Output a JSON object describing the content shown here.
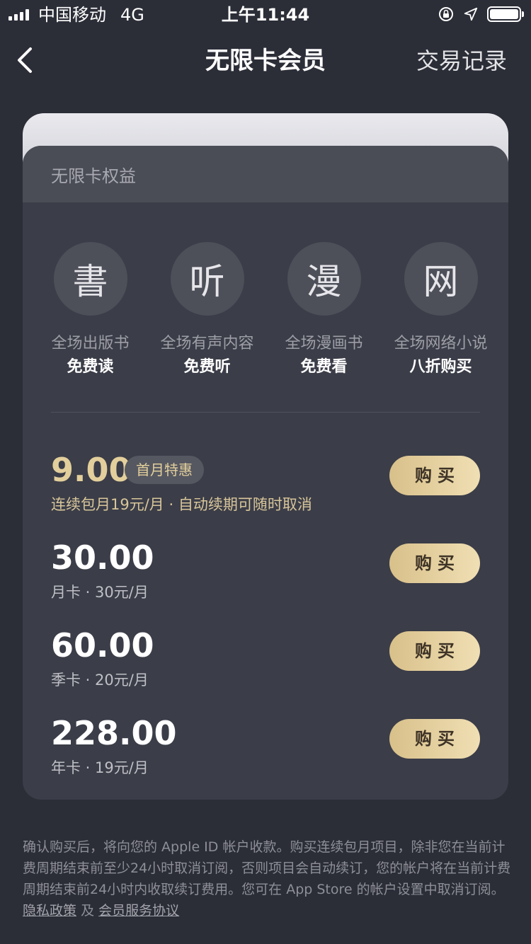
{
  "status_bar": {
    "carrier": "中国移动",
    "network": "4G",
    "time": "上午11:44"
  },
  "nav": {
    "title": "无限卡会员",
    "right_label": "交易记录"
  },
  "card": {
    "header": "无限卡权益",
    "benefits": [
      {
        "glyph": "書",
        "desc": "全场出版书",
        "value": "免费读"
      },
      {
        "glyph": "听",
        "desc": "全场有声内容",
        "value": "免费听"
      },
      {
        "glyph": "漫",
        "desc": "全场漫画书",
        "value": "免费看"
      },
      {
        "glyph": "网",
        "desc": "全场网络小说",
        "value": "八折购买"
      }
    ],
    "plans": [
      {
        "price": "9.00",
        "badge": "首月特惠",
        "sub": "连续包月19元/月 · 自动续期可随时取消",
        "buy": "购买"
      },
      {
        "price": "30.00",
        "sub": "月卡 · 30元/月",
        "buy": "购买"
      },
      {
        "price": "60.00",
        "sub": "季卡 · 20元/月",
        "buy": "购买"
      },
      {
        "price": "228.00",
        "sub": "年卡 · 19元/月",
        "buy": "购买"
      }
    ]
  },
  "notice": {
    "text": "确认购买后，将向您的 Apple ID 帐户收款。购买连续包月项目，除非您在当前计费周期结束前至少24小时取消订阅，否则项目会自动续订，您的帐户将在当前计费周期结束前24小时内收取续订费用。您可在 App Store 的帐户设置中取消订阅。",
    "privacy_link": "隐私政策",
    "and": "及",
    "service_link": "会员服务协议"
  },
  "colors": {
    "background": "#2b2d37",
    "card": "#3b3d48",
    "gold": "#e3cf9c",
    "buy_button": "#e6d19f"
  }
}
